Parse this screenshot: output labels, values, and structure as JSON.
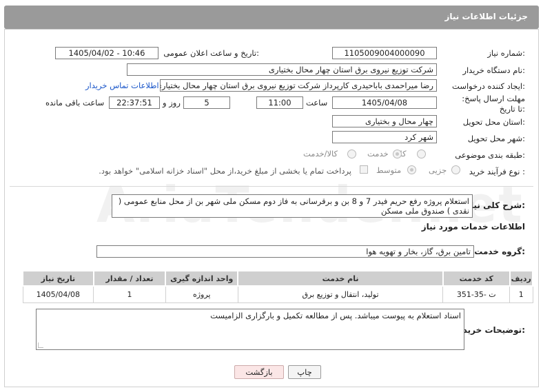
{
  "header": {
    "title": "جزئیات اطلاعات نیاز"
  },
  "fields": {
    "need_number": {
      "label": "شماره نیاز:",
      "value": "1105009004000090"
    },
    "announce_datetime": {
      "label": "تاریخ و ساعت اعلان عمومی:",
      "value": "1405/04/02 - 10:46"
    },
    "buyer_org": {
      "label": "نام دستگاه خریدار:",
      "value": "شرکت توزیع نیروی برق استان چهار محال بختیاری"
    },
    "requester": {
      "label": "ایجاد کننده درخواست:",
      "value": "رضا میراحمدی باباحیدری کارپرداز شرکت توزیع نیروی برق استان چهار محال بختیاری",
      "link": "اطلاعات تماس خریدار"
    },
    "deadline": {
      "label": "مهلت ارسال پاسخ: تا تاریخ:",
      "date": "1405/04/08",
      "time_label": "ساعت",
      "time": "11:00",
      "days": "5",
      "days_label": "روز و",
      "remaining": "22:37:51",
      "remaining_label": "ساعت باقی مانده"
    },
    "province": {
      "label": "استان محل تحویل:",
      "value": "چهار محال و بختیاری"
    },
    "city": {
      "label": "شهر محل تحویل:",
      "value": "شهر کرد"
    },
    "category": {
      "label": "طبقه بندی موضوعی:",
      "options": [
        "کالا",
        "خدمت",
        "کالا/خدمت"
      ],
      "selected": "خدمت"
    },
    "purchase_type": {
      "label": "نوع فرآیند خرید :",
      "options": [
        "جزیی",
        "متوسط"
      ],
      "selected": "متوسط",
      "note": "پرداخت تمام یا بخشی از مبلغ خرید،از محل \"اسناد خزانه اسلامی\" خواهد بود."
    }
  },
  "summary": {
    "label": "شرح کلی نیاز:",
    "value": "استعلام پروژه رفع حریم فیدر 7 و 8 بن و برقرسانی به فاز دوم مسکن ملی شهر بن از محل منابع عمومی ( نقدی ) صندوق ملی مسکن"
  },
  "services": {
    "heading": "اطلاعات خدمات مورد نیاز",
    "group_label": "گروه خدمت:",
    "group_value": "تامین برق، گاز، بخار و تهویه هوا",
    "columns": [
      "ردیف",
      "کد خدمت",
      "نام خدمت",
      "واحد اندازه گیری",
      "تعداد / مقدار",
      "تاریخ نیاز"
    ],
    "rows": [
      [
        "1",
        "ت -35-351",
        "تولید، انتقال و توزیع برق",
        "پروژه",
        "1",
        "1405/04/08"
      ]
    ]
  },
  "buyer_notes": {
    "label": "توضیحات خریدار:",
    "value": "اسناد استعلام به پیوست میباشد. پس از مطالعه تکمیل و بارگزاری الزامیست"
  },
  "buttons": {
    "print": "چاپ",
    "back": "بازگشت"
  },
  "watermark": "AriaTender.net"
}
